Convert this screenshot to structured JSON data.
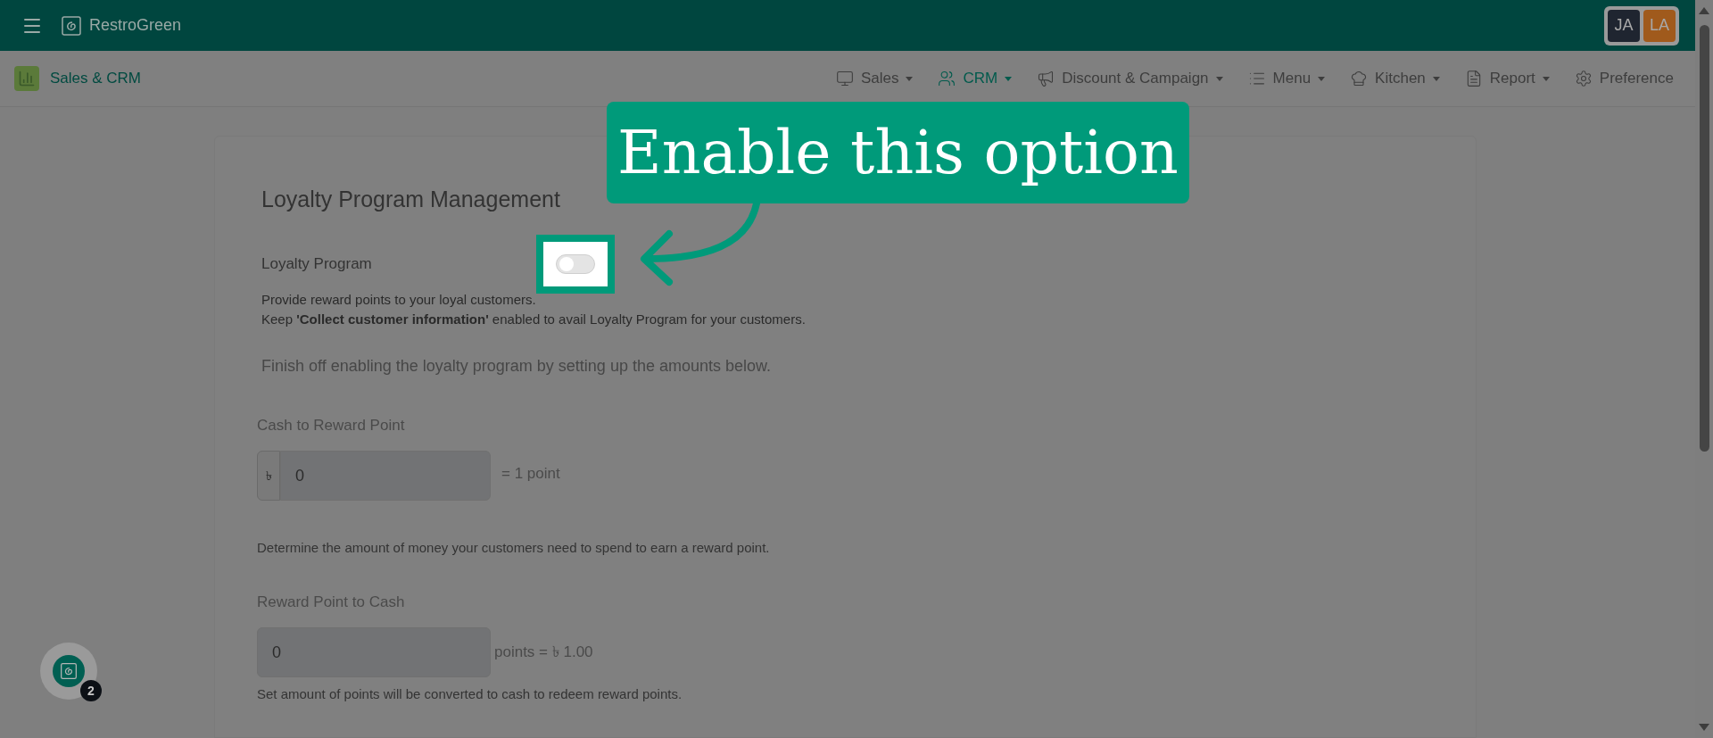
{
  "app": {
    "name": "RestroGreen"
  },
  "users": [
    {
      "initials": "JA",
      "color": "#1f2530"
    },
    {
      "initials": "LA",
      "color": "#a05a1c"
    }
  ],
  "module": "Sales & CRM",
  "nav": [
    {
      "label": "Sales",
      "selected": false,
      "dropdown": true
    },
    {
      "label": "CRM",
      "selected": true,
      "dropdown": true
    },
    {
      "label": "Discount & Campaign",
      "selected": false,
      "dropdown": true
    },
    {
      "label": "Menu",
      "selected": false,
      "dropdown": true
    },
    {
      "label": "Kitchen",
      "selected": false,
      "dropdown": true
    },
    {
      "label": "Report",
      "selected": false,
      "dropdown": true
    },
    {
      "label": "Preference",
      "selected": false,
      "dropdown": false
    }
  ],
  "annotation": {
    "text": "Enable this option"
  },
  "loyalty": {
    "title": "Loyalty Program Management",
    "toggle": {
      "label": "Loyalty Program",
      "on": false
    },
    "descriptions": [
      "Provide reward points to your loyal customers.",
      "Keep **'Collect customer information'** enabled to avail Loyalty Program for your customers."
    ],
    "intro": "Finish off enabling the loyalty program by setting up the amounts below.",
    "sections": [
      {
        "label": "Cash to Reward Point",
        "prefix": "৳",
        "value": "0",
        "suffix": "= 1 point",
        "help": "Determine the amount of money your customers need to spend to earn a reward point."
      },
      {
        "label": "Reward Point to Cash",
        "value": "0",
        "suffix": "points = ৳ 1.00",
        "help": "Set amount of points will be converted to cash to redeem reward points."
      }
    ]
  },
  "chat_badge": {
    "count": "2"
  }
}
